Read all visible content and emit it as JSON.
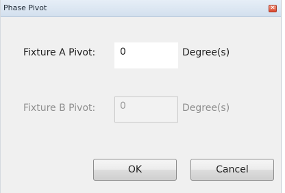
{
  "window": {
    "title": "Phase Pivot",
    "close_glyph": "✕"
  },
  "fixture_a": {
    "label": "Fixture A Pivot:",
    "value": "0",
    "unit": "Degree(s)",
    "enabled": true
  },
  "fixture_b": {
    "label": "Fixture B Pivot:",
    "value": "0",
    "unit": "Degree(s)",
    "enabled": false
  },
  "buttons": {
    "ok_label": "OK",
    "cancel_label": "Cancel"
  },
  "colors": {
    "close_button": "#d9442a",
    "disabled_text": "#8e8e8e"
  }
}
